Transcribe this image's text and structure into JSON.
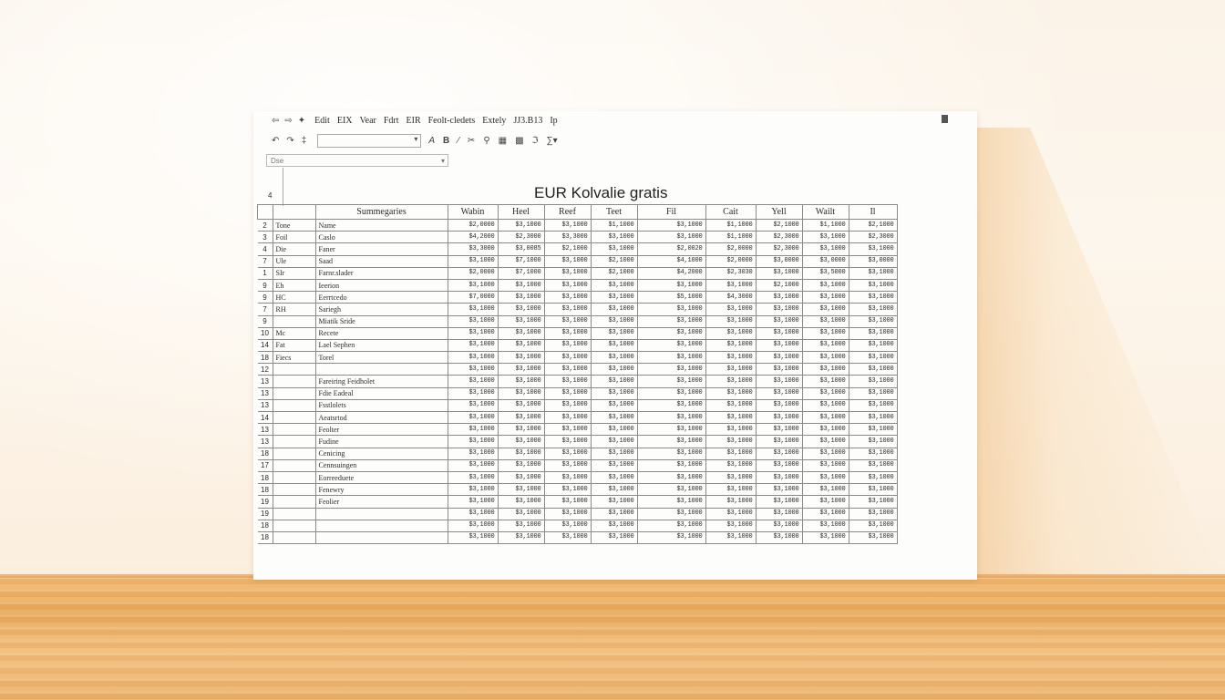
{
  "menubar": {
    "nav_icons": [
      "back-icon",
      "forward-icon",
      "pin-icon"
    ],
    "menus": [
      "Edit",
      "EIX",
      "Vear",
      "Fdrt",
      "EIR",
      "Feolt-cledets",
      "Extely",
      "JJ3.B13",
      "Ip"
    ]
  },
  "toolbar": {
    "icons": [
      "undo-icon",
      "redo-icon",
      "font-size-icon",
      "font-dropdown",
      "italic-icon",
      "bold-icon",
      "pen-icon",
      "cut-icon",
      "search-icon",
      "table-icon",
      "grid-icon",
      "format-icon",
      "sum-icon"
    ]
  },
  "namebox": {
    "value": "Dse"
  },
  "side_label": "4",
  "title": "EUR Kolvalie gratis",
  "columns": [
    "",
    "",
    "Summegaries",
    "Wabin",
    "Heel",
    "Reef",
    "Teet",
    "Fil",
    "Cait",
    "Yell",
    "Wailt",
    "Il"
  ],
  "rows": [
    {
      "rn": "2",
      "c1": "Tone",
      "c2": "Name",
      "v": [
        "$2,0000",
        "$3,1000",
        "$3,1000",
        "$1,1000",
        "$3,1000",
        "$1,1000",
        "$2,1000",
        "$1,1000",
        "$2,1000"
      ]
    },
    {
      "rn": "3",
      "c1": "Foil",
      "c2": "Caslo",
      "v": [
        "$4,2000",
        "$2,3000",
        "$3,3000",
        "$3,1000",
        "$3,1000",
        "$1,1000",
        "$2,3000",
        "$3,1000",
        "$2,3000"
      ]
    },
    {
      "rn": "4",
      "c1": "Die",
      "c2": "Faner",
      "v": [
        "$3,3000",
        "$3,0085",
        "$2,1000",
        "$3,1000",
        "$2,0020",
        "$2,0000",
        "$2,3000",
        "$3,1000",
        "$3,1000"
      ]
    },
    {
      "rn": "7",
      "c1": "Ule",
      "c2": "Saad",
      "v": [
        "$3,1000",
        "$7,1000",
        "$3,1000",
        "$2,1000",
        "$4,1000",
        "$2,0000",
        "$3,0000",
        "$3,0000",
        "$3,0000"
      ]
    },
    {
      "rn": "1",
      "c1": "SIr",
      "c2": "Farnr.slader",
      "v": [
        "$2,0000",
        "$7,1000",
        "$3,1000",
        "$2,1000",
        "$4,2000",
        "$2,3030",
        "$3,1000",
        "$3,5000",
        "$3,1000"
      ]
    },
    {
      "rn": "9",
      "c1": "Eh",
      "c2": "Ieerion",
      "v": [
        "$3,1000",
        "$3,1000",
        "$3,1000",
        "$3,1000",
        "$3,1000",
        "$3,1000",
        "$2,1000",
        "$3,1000",
        "$3,1000"
      ]
    },
    {
      "rn": "9",
      "c1": "HC",
      "c2": "Eerrtcedo",
      "v": [
        "$7,0000",
        "$3,1000",
        "$3,1000",
        "$3,1000",
        "$5,1000",
        "$4,3000",
        "$3,1000",
        "$3,1000",
        "$3,1000"
      ]
    },
    {
      "rn": "7",
      "c1": "RH",
      "c2": "Sariegh",
      "v": [
        "$3,1000",
        "$3,1000",
        "$3,1000",
        "$3,1000",
        "$3,1000",
        "$3,1000",
        "$3,1000",
        "$3,1000",
        "$3,1000"
      ]
    },
    {
      "rn": "9",
      "c1": "",
      "c2": "Miatik Sride",
      "v": [
        "$3,1000",
        "$3,1000",
        "$3,1000",
        "$3,1000",
        "$3,1000",
        "$3,1000",
        "$3,1000",
        "$3,1000",
        "$3,1000"
      ]
    },
    {
      "rn": "10",
      "c1": "Mc",
      "c2": "Recete",
      "v": [
        "$3,1000",
        "$3,1000",
        "$3,1000",
        "$3,1000",
        "$3,1000",
        "$3,1000",
        "$3,1000",
        "$3,1000",
        "$3,1000"
      ]
    },
    {
      "rn": "14",
      "c1": "Fat",
      "c2": "Lael Sephen",
      "v": [
        "$3,1000",
        "$3,1000",
        "$3,1000",
        "$3,1000",
        "$3,1000",
        "$3,1000",
        "$3,1000",
        "$3,1000",
        "$3,1000"
      ]
    },
    {
      "rn": "18",
      "c1": "Fiecs",
      "c2": "Torel",
      "v": [
        "$3,1000",
        "$3,1000",
        "$3,1000",
        "$3,1000",
        "$3,1000",
        "$3,1000",
        "$3,1000",
        "$3,1000",
        "$3,1000"
      ]
    },
    {
      "rn": "12",
      "c1": "",
      "c2": "",
      "v": [
        "$3,1000",
        "$3,1000",
        "$3,1000",
        "$3,1000",
        "$3,1000",
        "$3,1000",
        "$3,1000",
        "$3,1000",
        "$3,1000"
      ]
    },
    {
      "rn": "13",
      "c1": "",
      "c2": "Fareiring Feidholet",
      "v": [
        "$3,1000",
        "$3,1000",
        "$3,1000",
        "$3,1000",
        "$3,1000",
        "$3,1000",
        "$3,1000",
        "$3,1000",
        "$3,1000"
      ]
    },
    {
      "rn": "13",
      "c1": "",
      "c2": "Fdie Eadeal",
      "v": [
        "$3,1000",
        "$3,1000",
        "$3,1000",
        "$3,1000",
        "$3,1000",
        "$3,1000",
        "$3,1000",
        "$3,1000",
        "$3,1000"
      ]
    },
    {
      "rn": "13",
      "c1": "",
      "c2": "Fsstlolets",
      "v": [
        "$3,1000",
        "$3,1000",
        "$3,1000",
        "$3,1000",
        "$3,1000",
        "$3,1000",
        "$3,1000",
        "$3,1000",
        "$3,1000"
      ]
    },
    {
      "rn": "14",
      "c1": "",
      "c2": "Aeatsrtod",
      "v": [
        "$3,1000",
        "$3,1000",
        "$3,1000",
        "$3,1000",
        "$3,1000",
        "$3,1000",
        "$3,1000",
        "$3,1000",
        "$3,1000"
      ]
    },
    {
      "rn": "13",
      "c1": "",
      "c2": "Feolter",
      "v": [
        "$3,1000",
        "$3,1000",
        "$3,1000",
        "$3,1000",
        "$3,1000",
        "$3,1000",
        "$3,1000",
        "$3,1000",
        "$3,1000"
      ]
    },
    {
      "rn": "13",
      "c1": "",
      "c2": "Fudine",
      "v": [
        "$3,1000",
        "$3,1000",
        "$3,1000",
        "$3,1000",
        "$3,1000",
        "$3,1000",
        "$3,1000",
        "$3,1000",
        "$3,1000"
      ]
    },
    {
      "rn": "18",
      "c1": "",
      "c2": "Cenicing",
      "v": [
        "$3,1000",
        "$3,1000",
        "$3,1000",
        "$3,1000",
        "$3,1000",
        "$3,1000",
        "$3,1000",
        "$3,1000",
        "$3,1000"
      ]
    },
    {
      "rn": "17",
      "c1": "",
      "c2": "Cennsuingen",
      "v": [
        "$3,1000",
        "$3,1000",
        "$3,1000",
        "$3,1000",
        "$3,1000",
        "$3,1000",
        "$3,1000",
        "$3,1000",
        "$3,1000"
      ]
    },
    {
      "rn": "18",
      "c1": "",
      "c2": "Eorreeduete",
      "v": [
        "$3,1000",
        "$3,1000",
        "$3,1000",
        "$3,1000",
        "$3,1000",
        "$3,1000",
        "$3,1000",
        "$3,1000",
        "$3,1000"
      ]
    },
    {
      "rn": "18",
      "c1": "",
      "c2": "Fenewry",
      "v": [
        "$3,1000",
        "$3,1000",
        "$3,1000",
        "$3,1000",
        "$3,1000",
        "$3,1000",
        "$3,1000",
        "$3,1000",
        "$3,1000"
      ]
    },
    {
      "rn": "19",
      "c1": "",
      "c2": "Feolier",
      "v": [
        "$3,1000",
        "$3,1000",
        "$3,1000",
        "$3,1000",
        "$3,1000",
        "$3,1000",
        "$3,1000",
        "$3,1000",
        "$3,1000"
      ]
    },
    {
      "rn": "19",
      "c1": "",
      "c2": "",
      "v": [
        "$3,1000",
        "$3,1000",
        "$3,1000",
        "$3,1000",
        "$3,1000",
        "$3,1000",
        "$3,1000",
        "$3,1000",
        "$3,1000"
      ]
    },
    {
      "rn": "18",
      "c1": "",
      "c2": "",
      "v": [
        "$3,1000",
        "$3,1000",
        "$3,1000",
        "$3,1000",
        "$3,1000",
        "$3,1000",
        "$3,1000",
        "$3,1000",
        "$3,1000"
      ]
    },
    {
      "rn": "18",
      "c1": "",
      "c2": "",
      "v": [
        "$3,1000",
        "$3,1000",
        "$3,1000",
        "$3,1000",
        "$3,1000",
        "$3,1000",
        "$3,1000",
        "$3,1000",
        "$3,1000"
      ]
    }
  ]
}
